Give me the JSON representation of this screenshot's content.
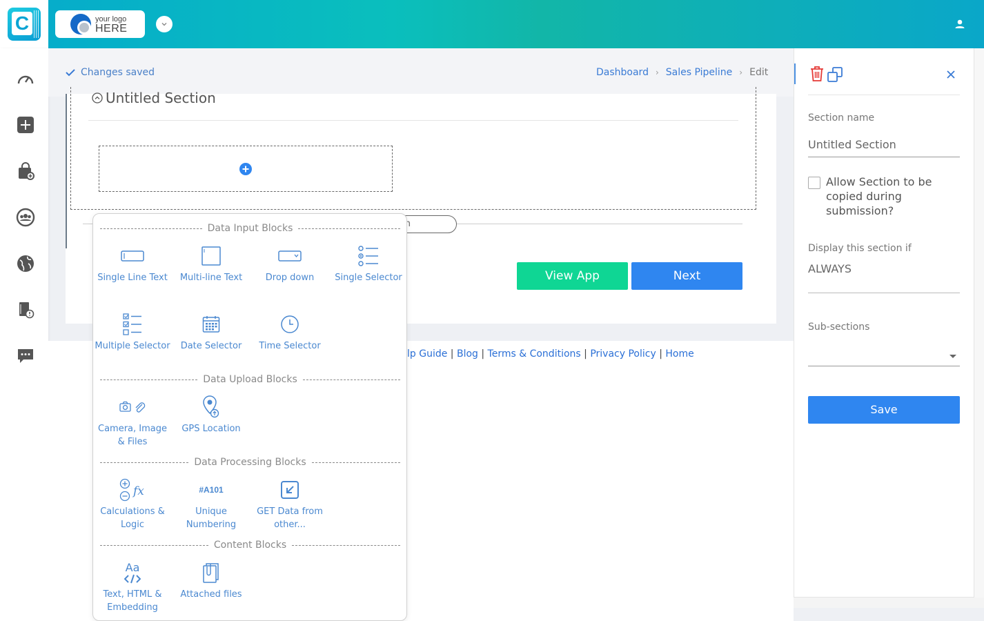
{
  "header": {
    "brand_small": "your logo",
    "brand_big": "HERE"
  },
  "status": {
    "saved_text": "Changes saved"
  },
  "breadcrumb": {
    "items": [
      "Dashboard",
      "Sales Pipeline"
    ],
    "current": "Edit"
  },
  "section": {
    "title": "Untitled Section",
    "add_section_label": "l Section"
  },
  "buttons": {
    "view_app": "View App",
    "next": "Next",
    "save": "Save"
  },
  "footer": {
    "links": [
      "lp Guide",
      "Blog",
      "Terms & Conditions",
      "Privacy Policy",
      "Home"
    ]
  },
  "palette": {
    "groups": [
      {
        "title": "Data Input Blocks",
        "items": [
          {
            "label": "Single Line Text",
            "icon": "single-line-text-icon"
          },
          {
            "label": "Multi-line Text",
            "icon": "multi-line-text-icon"
          },
          {
            "label": "Drop down",
            "icon": "dropdown-icon"
          },
          {
            "label": "Single Selector",
            "icon": "single-selector-icon"
          },
          {
            "label": "Multiple Selector",
            "icon": "multiple-selector-icon"
          },
          {
            "label": "Date Selector",
            "icon": "calendar-icon"
          },
          {
            "label": "Time Selector",
            "icon": "clock-icon"
          }
        ]
      },
      {
        "title": "Data Upload Blocks",
        "items": [
          {
            "label": "Camera, Image & Files",
            "icon": "camera-clip-icon"
          },
          {
            "label": "GPS Location",
            "icon": "gps-pin-icon"
          }
        ]
      },
      {
        "title": "Data Processing Blocks",
        "items": [
          {
            "label": "Calculations & Logic",
            "icon": "calculation-fx-icon"
          },
          {
            "label": "Unique Numbering",
            "icon": "hash-numbering-icon",
            "icon_text": "#A101"
          },
          {
            "label": "GET Data from other...",
            "icon": "get-data-icon"
          }
        ]
      },
      {
        "title": "Content Blocks",
        "items": [
          {
            "label": "Text, HTML & Embedding",
            "icon": "text-html-icon",
            "icon_text": "Aa"
          },
          {
            "label": "Attached files",
            "icon": "attached-files-icon"
          }
        ]
      }
    ]
  },
  "props": {
    "section_name_label": "Section name",
    "section_name_value": "Untitled Section",
    "allow_copy_label": "Allow Section to be copied during submission?",
    "display_if_label": "Display this section if",
    "display_if_value": "ALWAYS",
    "subsections_label": "Sub-sections"
  },
  "colors": {
    "accent_blue": "#2f86f0",
    "accent_green": "#0fd694",
    "link_blue": "#3a7bd5",
    "delete_red": "#e53935"
  }
}
